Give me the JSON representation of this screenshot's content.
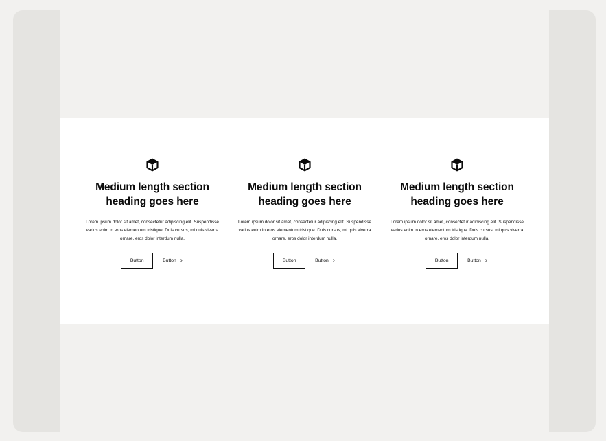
{
  "columns": [
    {
      "icon": "cube-icon",
      "heading": "Medium length section heading goes here",
      "body": "Lorem ipsum dolor sit amet, consectetur adipiscing elit. Suspendisse varius enim in eros elementum tristique. Duis cursus, mi quis viverra ornare, eros dolor interdum nulla.",
      "primary_button": "Button",
      "secondary_button": "Button",
      "secondary_icon": "chevron-right-icon"
    },
    {
      "icon": "cube-icon",
      "heading": "Medium length section heading goes here",
      "body": "Lorem ipsum dolor sit amet, consectetur adipiscing elit. Suspendisse varius enim in eros elementum tristique. Duis cursus, mi quis viverra ornare, eros dolor interdum nulla.",
      "primary_button": "Button",
      "secondary_button": "Button",
      "secondary_icon": "chevron-right-icon"
    },
    {
      "icon": "cube-icon",
      "heading": "Medium length section heading goes here",
      "body": "Lorem ipsum dolor sit amet, consectetur adipiscing elit. Suspendisse varius enim in eros elementum tristique. Duis cursus, mi quis viverra ornare, eros dolor interdum nulla.",
      "primary_button": "Button",
      "secondary_button": "Button",
      "secondary_icon": "chevron-right-icon"
    }
  ],
  "colors": {
    "page_background": "#f2f1ef",
    "frame_background": "#e5e4e1",
    "section_background": "#ffffff",
    "text": "#0b0b0b"
  }
}
